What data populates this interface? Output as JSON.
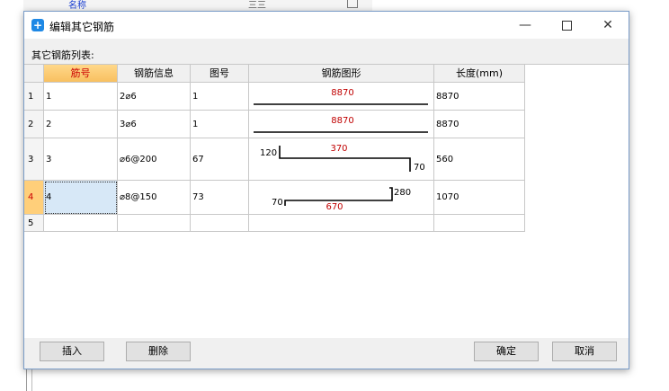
{
  "dialog": {
    "title": "编辑其它钢筋",
    "list_label": "其它钢筋列表:"
  },
  "window_controls": {
    "minimize": "—",
    "close": "✕"
  },
  "background": {
    "fragment1": "名称",
    "fragment2": "三三"
  },
  "table": {
    "columns": [
      "筋号",
      "钢筋信息",
      "图号",
      "钢筋图形",
      "长度(mm)"
    ],
    "rows": [
      {
        "num": "1",
        "bar_no": "1",
        "info": "2⌀6",
        "figure_no": "1",
        "length": "8870",
        "shape": {
          "type": "straight",
          "labels": [
            "8870"
          ]
        }
      },
      {
        "num": "2",
        "bar_no": "2",
        "info": "3⌀6",
        "figure_no": "1",
        "length": "8870",
        "shape": {
          "type": "straight",
          "labels": [
            "8870"
          ]
        }
      },
      {
        "num": "3",
        "bar_no": "3",
        "info": "⌀6@200",
        "figure_no": "67",
        "length": "560",
        "shape": {
          "type": "z-bend",
          "labels": [
            "120",
            "370",
            "70"
          ]
        }
      },
      {
        "num": "4",
        "bar_no": "4",
        "info": "⌀8@150",
        "figure_no": "73",
        "length": "1070",
        "shape": {
          "type": "hook-bend",
          "labels": [
            "70",
            "670",
            "280"
          ]
        }
      },
      {
        "num": "5",
        "bar_no": "",
        "info": "",
        "figure_no": "",
        "length": ""
      }
    ]
  },
  "buttons": {
    "insert": "插入",
    "delete": "删除",
    "ok": "确定",
    "cancel": "取消"
  },
  "colors": {
    "accent_red": "#c00000",
    "selection": "#d7e8f7",
    "active_header": "#f8c060"
  }
}
